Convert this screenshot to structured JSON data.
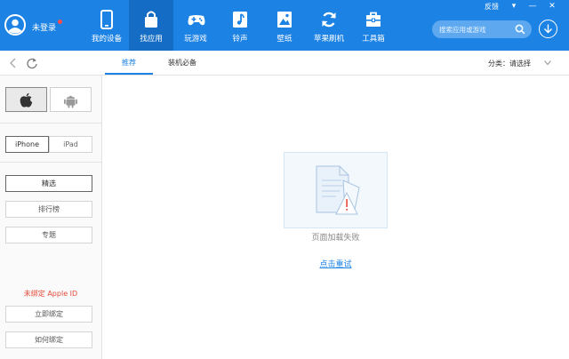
{
  "colors": {
    "topbar": "#1c82e4",
    "active_nav": "#146cc4",
    "accent": "#1c82e4",
    "warning": "#e34a3a"
  },
  "user": {
    "login_label": "未登录",
    "avatar_icon": "user-avatar-icon"
  },
  "nav": [
    {
      "label": "我的设备",
      "icon": "phone-icon",
      "active": false
    },
    {
      "label": "找应用",
      "icon": "bag-icon",
      "active": true
    },
    {
      "label": "玩游戏",
      "icon": "gamepad-icon",
      "active": false
    },
    {
      "label": "铃声",
      "icon": "music-icon",
      "active": false
    },
    {
      "label": "壁纸",
      "icon": "image-icon",
      "active": false
    },
    {
      "label": "苹果刷机",
      "icon": "refresh-icon",
      "active": false
    },
    {
      "label": "工具箱",
      "icon": "toolbox-icon",
      "active": false
    }
  ],
  "window": {
    "feedback_label": "反馈",
    "menu_glyph": "▾",
    "minimize_glyph": "—",
    "close_glyph": "✕"
  },
  "search": {
    "placeholder": "搜索应用或游戏"
  },
  "tabs": [
    {
      "label": "推荐",
      "active": true
    },
    {
      "label": "装机必备",
      "active": false
    }
  ],
  "category": {
    "label": "分类：请选择"
  },
  "sidebar": {
    "os_buttons": [
      {
        "name": "apple",
        "icon": "apple-icon",
        "active": true
      },
      {
        "name": "android",
        "icon": "android-icon",
        "active": false
      }
    ],
    "devices": [
      {
        "label": "iPhone",
        "active": true
      },
      {
        "label": "iPad",
        "active": false
      }
    ],
    "sections": [
      {
        "label": "精选",
        "active": true
      },
      {
        "label": "排行榜",
        "active": false
      },
      {
        "label": "专题",
        "active": false
      }
    ],
    "apple_id_status": "未绑定 Apple ID",
    "bind_now_label": "立即绑定",
    "how_to_bind_label": "如何绑定"
  },
  "content": {
    "error_icon": "broken-document-icon",
    "error_message": "页面加载失败",
    "retry_label": "点击重试"
  }
}
